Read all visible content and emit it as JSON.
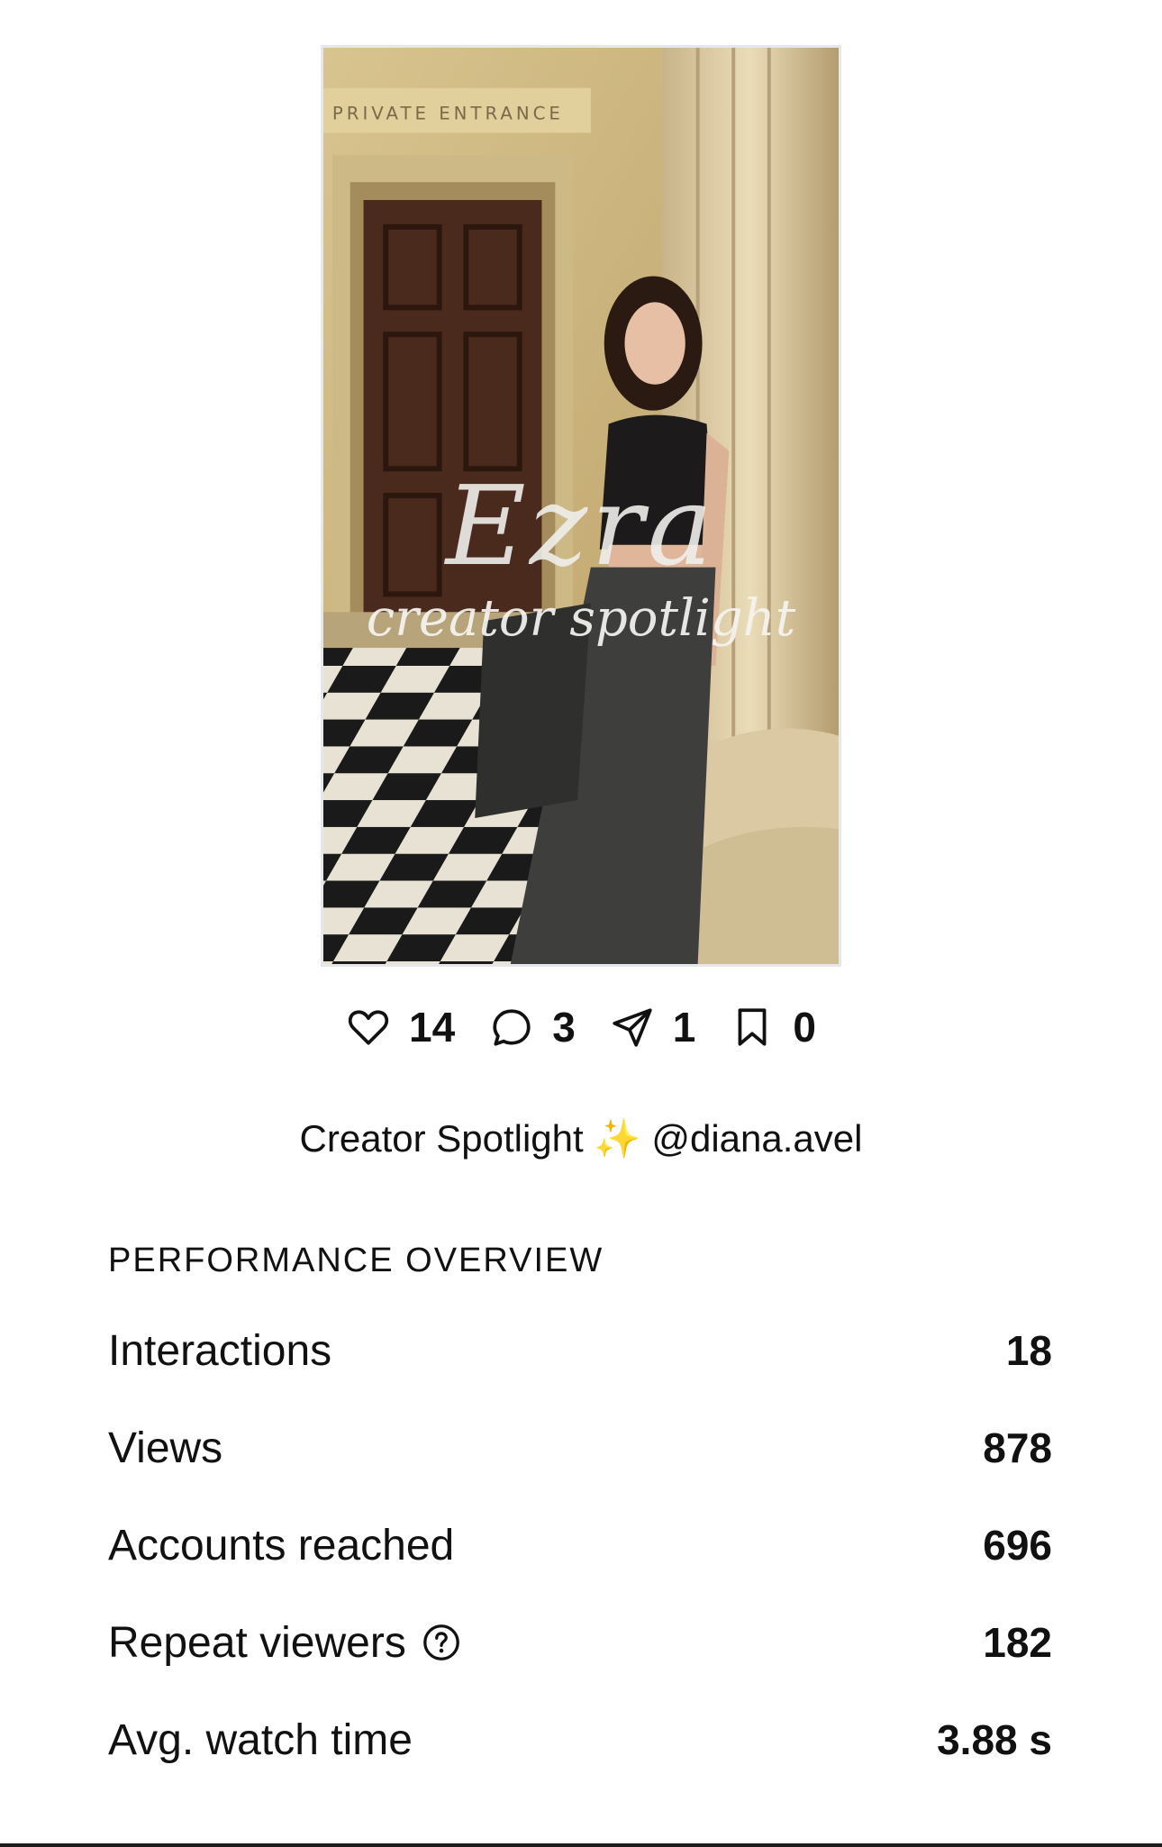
{
  "media": {
    "overlay_title": "Ezra",
    "overlay_subtitle": "creator spotlight",
    "sign_text": "PRIVATE  ENTRANCE"
  },
  "engagement": {
    "likes": {
      "icon": "heart-icon",
      "count": "14"
    },
    "comments": {
      "icon": "comment-icon",
      "count": "3"
    },
    "shares": {
      "icon": "paper-plane-icon",
      "count": "1"
    },
    "saves": {
      "icon": "bookmark-icon",
      "count": "0"
    }
  },
  "caption": "Creator Spotlight ✨ @diana.avel",
  "performance": {
    "heading": "PERFORMANCE OVERVIEW",
    "metrics": [
      {
        "label": "Interactions",
        "value": "18"
      },
      {
        "label": "Views",
        "value": "878"
      },
      {
        "label": "Accounts reached",
        "value": "696"
      },
      {
        "label": "Repeat viewers",
        "value": "182",
        "icon": "help-circle-icon"
      },
      {
        "label": "Avg. watch time",
        "value": "3.88 s"
      }
    ]
  }
}
